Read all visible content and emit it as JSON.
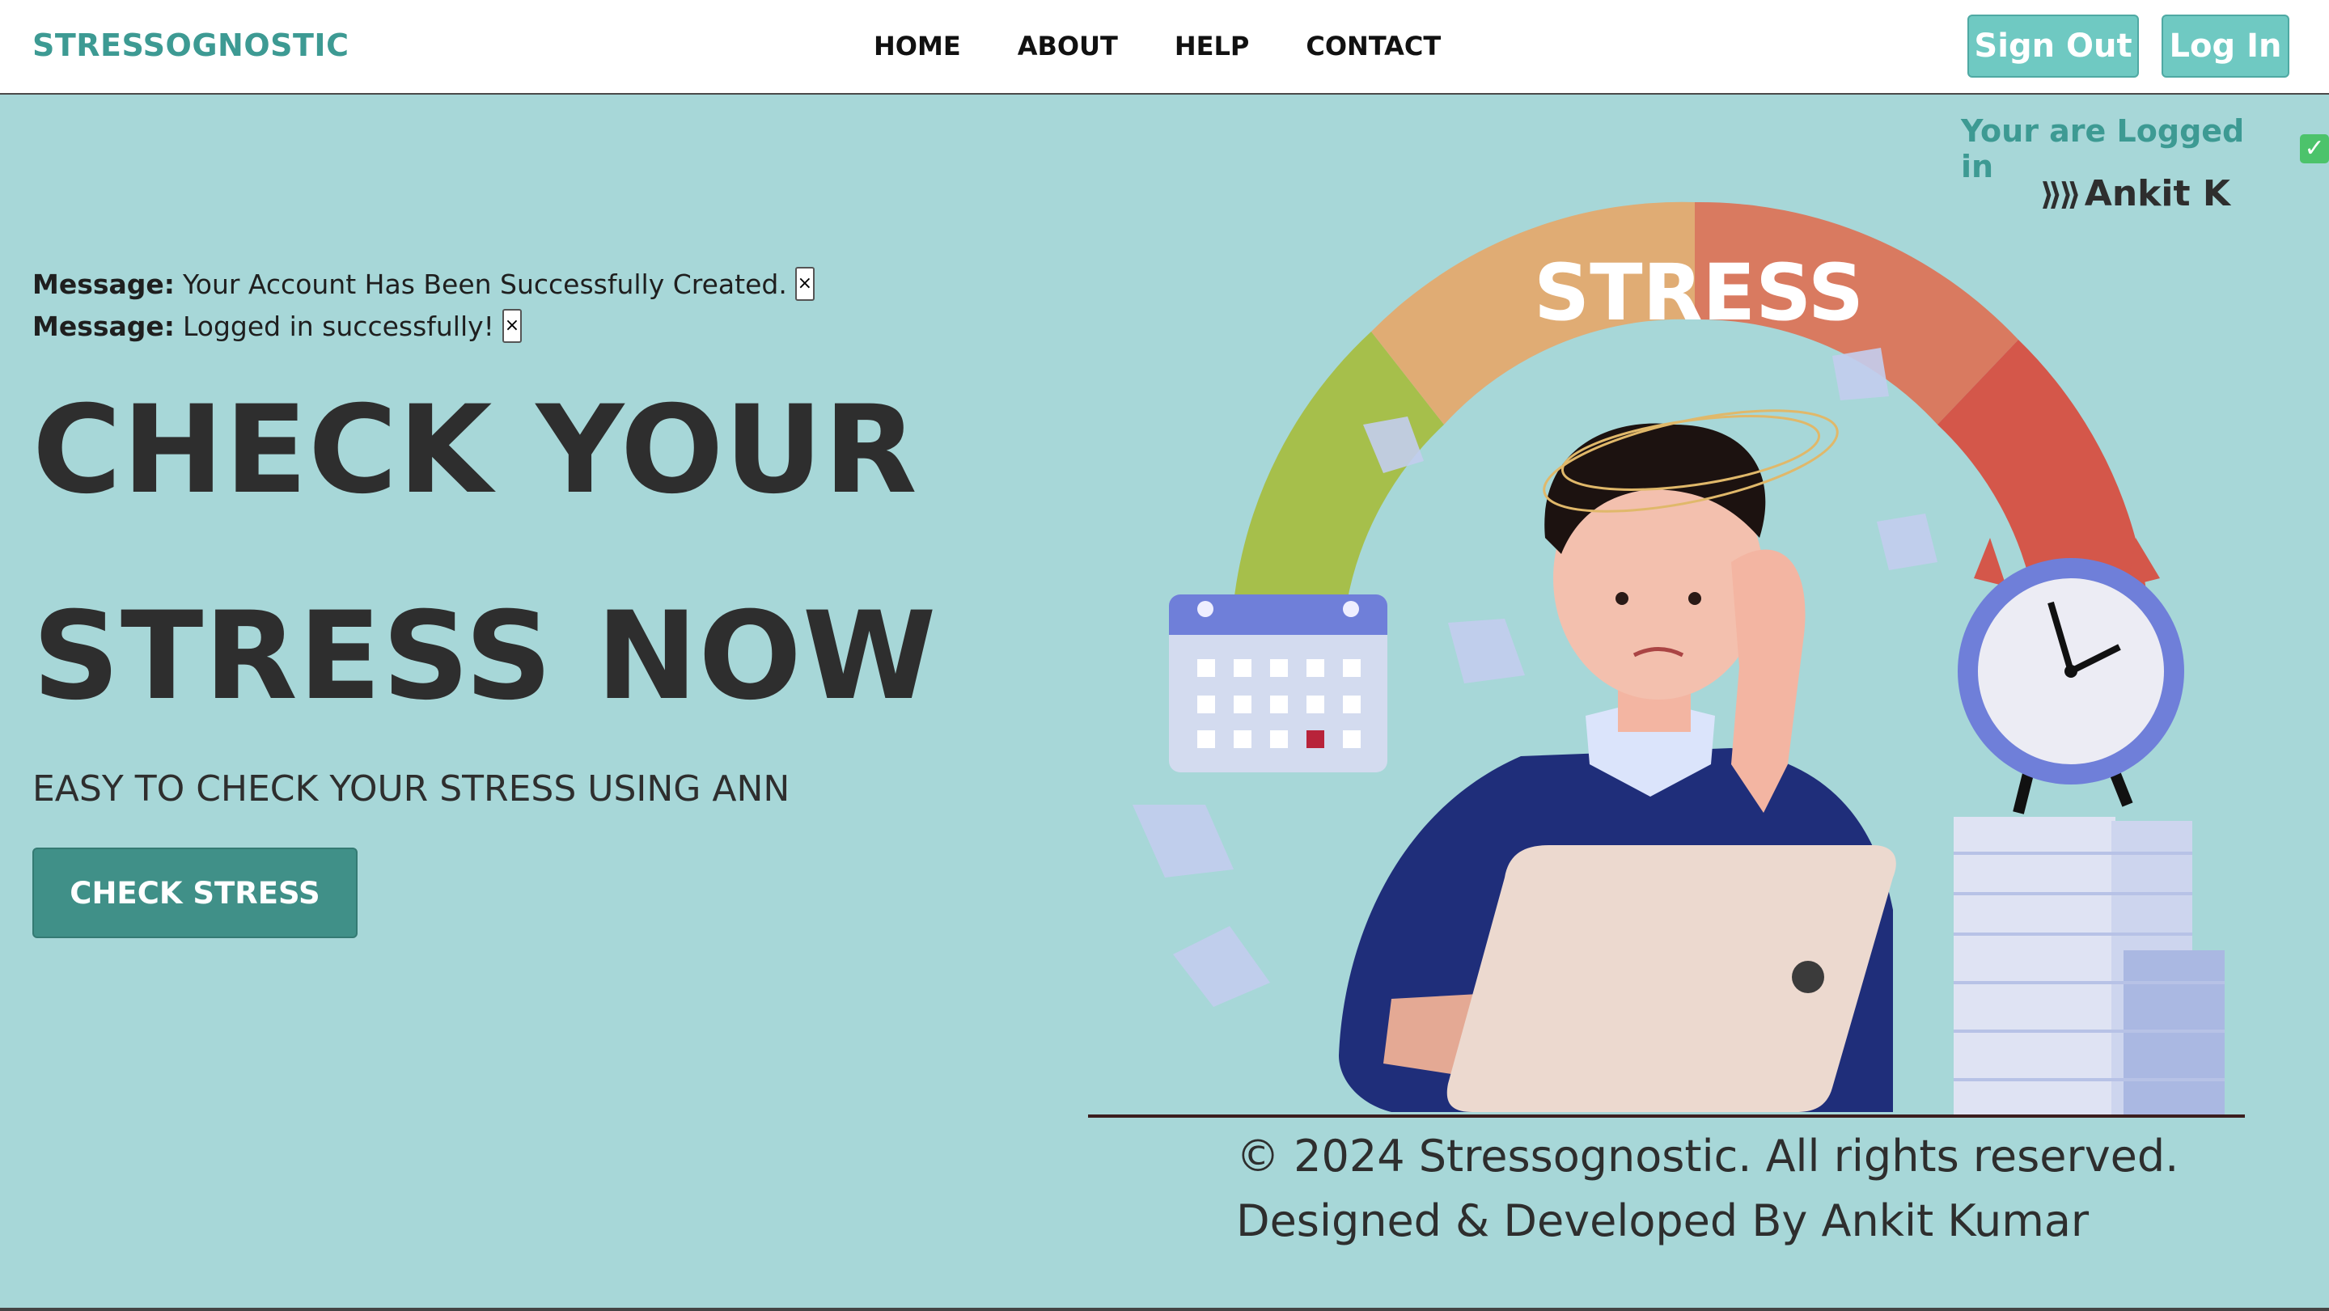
{
  "navbar": {
    "brand": "STRESSOGNOSTIC",
    "links": [
      "HOME",
      "ABOUT",
      "HELP",
      "CONTACT"
    ],
    "sign_out": "Sign Out",
    "log_in": "Log In"
  },
  "status": {
    "logged_in_text": "Your are Logged in",
    "check_glyph": "✓",
    "chevrons": "⟫⟫",
    "username": "Ankit K"
  },
  "messages": [
    {
      "label": "Message:",
      "text": "Your Account Has Been Successfully Created.",
      "close": "×"
    },
    {
      "label": "Message:",
      "text": "Logged in successfully!",
      "close": "×"
    }
  ],
  "hero": {
    "line1": "CHECK YOUR",
    "line2": "STRESS NOW",
    "subtitle": "EASY TO CHECK YOUR STRESS USING ANN",
    "cta": "CHECK STRESS"
  },
  "illustration": {
    "gauge_label": "STRESS"
  },
  "footer": {
    "copyright": "© 2024 Stressognostic. All rights reserved.",
    "credit": "Designed & Developed By Ankit Kumar"
  },
  "colors": {
    "background": "#a7d7d8",
    "brand": "#3d9a93",
    "cta": "#409088",
    "nav_button": "#6fc9c2",
    "check": "#4cc36b"
  }
}
